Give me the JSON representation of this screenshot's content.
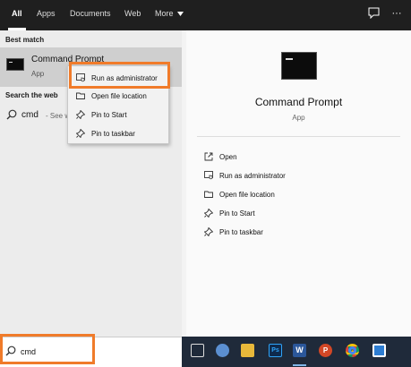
{
  "top_tabs": [
    {
      "label": "All",
      "active": true
    },
    {
      "label": "Apps",
      "active": false
    },
    {
      "label": "Documents",
      "active": false
    },
    {
      "label": "Web",
      "active": false
    },
    {
      "label": "More",
      "active": false
    }
  ],
  "top_icons": [
    "feedback-icon",
    "ellipsis-icon"
  ],
  "left": {
    "best_match_label": "Best match",
    "best_match": {
      "title": "Command Prompt",
      "subtitle": "App",
      "icon": "command-prompt-icon"
    },
    "search_web_label": "Search the web",
    "web_result": {
      "query": "cmd",
      "hint": "- See w"
    }
  },
  "context_menu": {
    "items": [
      {
        "label": "Run as administrator",
        "icon": "shield-admin-icon"
      },
      {
        "label": "Open file location",
        "icon": "folder-icon"
      },
      {
        "label": "Pin to Start",
        "icon": "pin-icon"
      },
      {
        "label": "Pin to taskbar",
        "icon": "pin-icon"
      }
    ]
  },
  "right": {
    "title": "Command Prompt",
    "subtitle": "App",
    "actions": [
      {
        "label": "Open",
        "icon": "open-icon"
      },
      {
        "label": "Run as administrator",
        "icon": "shield-admin-icon"
      },
      {
        "label": "Open file location",
        "icon": "folder-icon"
      },
      {
        "label": "Pin to Start",
        "icon": "pin-icon"
      },
      {
        "label": "Pin to taskbar",
        "icon": "pin-icon"
      }
    ]
  },
  "search": {
    "value": "cmd"
  },
  "taskbar_icons": [
    "task-view-icon",
    "file-explorer-icon",
    "photoshop-icon",
    "word-icon",
    "powerpoint-icon",
    "chrome-icon",
    "app-icon"
  ],
  "colors": {
    "highlight": "#f07b2a",
    "topbar": "#1f1f1f",
    "taskbar": "#1f2a3a"
  }
}
